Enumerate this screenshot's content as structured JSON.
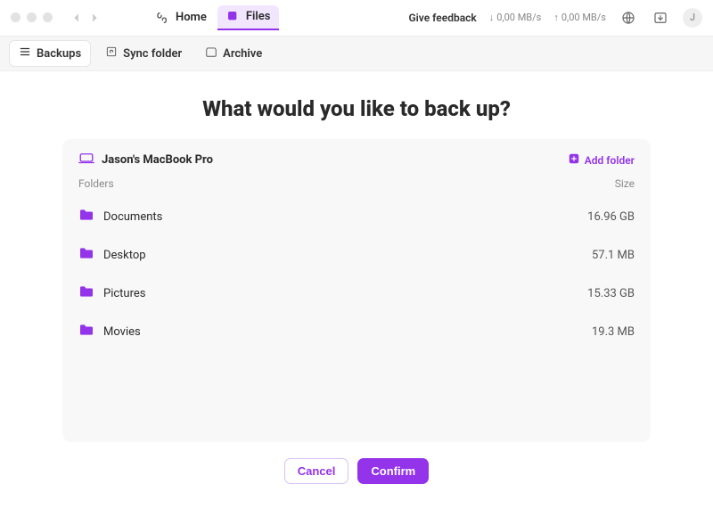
{
  "titlebar": {
    "tabs": [
      {
        "id": "home",
        "label": "Home",
        "icon": "home-icon",
        "active": false
      },
      {
        "id": "files",
        "label": "Files",
        "icon": "files-icon",
        "active": true
      }
    ],
    "feedback_label": "Give feedback",
    "speed_down": "0,00 MB/s",
    "speed_up": "0,00 MB/s",
    "avatar_initial": "J"
  },
  "subtabs": [
    {
      "id": "backups",
      "label": "Backups",
      "icon": "list-icon",
      "active": true
    },
    {
      "id": "sync",
      "label": "Sync folder",
      "icon": "sync-icon",
      "active": false
    },
    {
      "id": "archive",
      "label": "Archive",
      "icon": "archive-icon",
      "active": false
    }
  ],
  "page": {
    "headline": "What would you like to back up?",
    "device_name": "Jason's MacBook Pro",
    "add_folder_label": "Add folder",
    "columns": {
      "folders": "Folders",
      "size": "Size"
    },
    "rows": [
      {
        "name": "Documents",
        "size": "16.96 GB"
      },
      {
        "name": "Desktop",
        "size": "57.1 MB"
      },
      {
        "name": "Pictures",
        "size": "15.33 GB"
      },
      {
        "name": "Movies",
        "size": "19.3 MB"
      }
    ],
    "cancel_label": "Cancel",
    "confirm_label": "Confirm"
  },
  "colors": {
    "accent": "#9333ea"
  }
}
